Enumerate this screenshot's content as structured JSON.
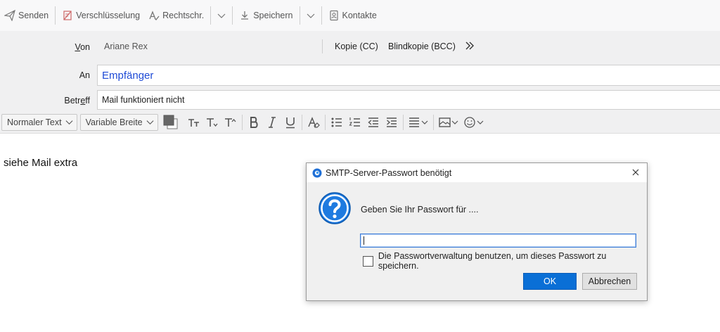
{
  "toolbar": {
    "send_label": "Senden",
    "encrypt_label": "Verschlüsselung",
    "spell_label": "Rechtschr.",
    "save_label": "Speichern",
    "contacts_label": "Kontakte"
  },
  "header": {
    "from_label_accel": "V",
    "from_label_rest": "on",
    "from_value": "Ariane Rex",
    "cc_label": "Kopie (CC)",
    "bcc_label": "Blindkopie (BCC)",
    "to_label": "An",
    "to_placeholder": "Empfänger",
    "subject_label_start": "Betr",
    "subject_label_accel": "e",
    "subject_label_end": "ff",
    "subject_value": "Mail funktioniert nicht"
  },
  "format": {
    "paragraph_style": "Normaler Text",
    "font_width": "Variable Breite"
  },
  "body": {
    "text": "siehe Mail extra"
  },
  "dialog": {
    "title": "SMTP-Server-Passwort benötigt",
    "message": "Geben Sie Ihr Passwort für  ....",
    "password_value": "",
    "checkbox_label": "Die Passwortverwaltung benutzen, um dieses Passwort zu speichern.",
    "ok_label": "OK",
    "cancel_label": "Abbrechen"
  },
  "colors": {
    "accent": "#0a6fd6",
    "recipient_placeholder": "#1f4bd6",
    "question_icon": "#1f7be0"
  }
}
